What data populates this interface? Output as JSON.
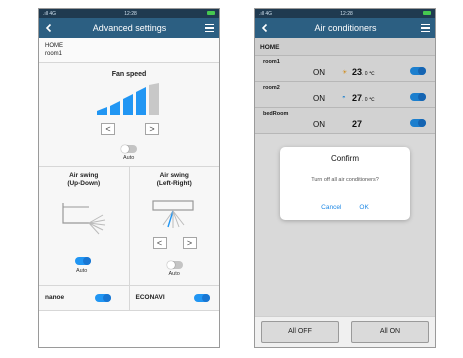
{
  "left_phone": {
    "status": {
      "signal": ".ıll 4G",
      "time": "12:28"
    },
    "title": "Advanced settings",
    "location": {
      "home": "HOME",
      "room": "room1"
    },
    "fan": {
      "title": "Fan speed",
      "prev": "<",
      "next": ">",
      "auto_label": "Auto",
      "auto_on": false,
      "level_fraction": 0.8
    },
    "swing_ud": {
      "title_line1": "Air swing",
      "title_line2": "(Up-Down)",
      "auto_label": "Auto",
      "auto_on": true
    },
    "swing_lr": {
      "title_line1": "Air swing",
      "title_line2": "(Left-Right)",
      "prev": "<",
      "next": ">",
      "auto_label": "Auto",
      "auto_on": false
    },
    "nanoe": {
      "label": "nanoe",
      "on": true
    },
    "econavi": {
      "label": "ECONAVI",
      "on": true
    }
  },
  "right_phone": {
    "status": {
      "signal": ".ıll 4G",
      "time": "12:28"
    },
    "title": "Air conditioners",
    "list_header": "HOME",
    "rooms": [
      {
        "name": "room1",
        "state": "ON",
        "temp": "23",
        "unit": ". 0 ℃",
        "mode_icon": "sun-icon",
        "icon_char": "☀",
        "on": true
      },
      {
        "name": "room2",
        "state": "ON",
        "temp": "27",
        "unit": ". 0 ℃",
        "mode_icon": "thermo-icon",
        "icon_char": "◓",
        "on": true
      },
      {
        "name": "bedRoom",
        "state": "ON",
        "temp": "27",
        "unit": "",
        "on": true
      }
    ],
    "dialog": {
      "title": "Confirm",
      "message": "Turn off all air conditioners?",
      "cancel": "Cancel",
      "ok": "OK"
    },
    "buttons": {
      "all_off": "All OFF",
      "all_on": "All ON"
    }
  },
  "colors": {
    "navbar": "#2c5f82",
    "toggle_on": "#2196f3",
    "fan_active": "#2196f3",
    "dialog_button": "#1e88e5"
  }
}
